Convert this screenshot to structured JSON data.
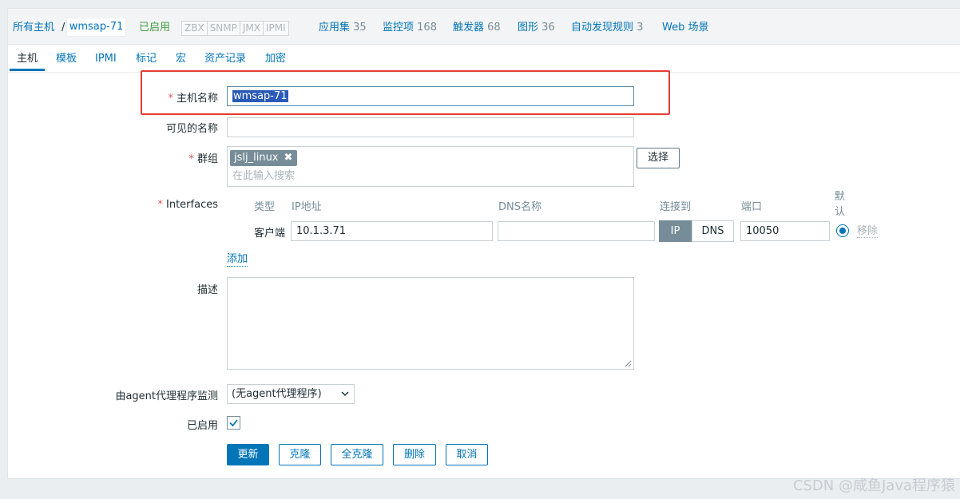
{
  "breadcrumb": {
    "all_hosts": "所有主机",
    "separator": "/",
    "host": "wmsap-71"
  },
  "header": {
    "status": "已启用",
    "availability": [
      "ZBX",
      "SNMP",
      "JMX",
      "IPMI"
    ],
    "links": [
      {
        "label": "应用集",
        "count": "35"
      },
      {
        "label": "监控项",
        "count": "168"
      },
      {
        "label": "触发器",
        "count": "68"
      },
      {
        "label": "图形",
        "count": "36"
      },
      {
        "label": "自动发现规则",
        "count": "3"
      },
      {
        "label": "Web 场景",
        "count": ""
      }
    ]
  },
  "tabs": [
    "主机",
    "模板",
    "IPMI",
    "标记",
    "宏",
    "资产记录",
    "加密"
  ],
  "form": {
    "required_mark": "*",
    "host_name_label": "主机名称",
    "host_name_value": "wmsap-71",
    "visible_name_label": "可见的名称",
    "visible_name_value": "",
    "groups_label": "群组",
    "group_tag": "jslj_linux",
    "group_tag_remove": "✖",
    "groups_placeholder": "在此输入搜索",
    "select_button": "选择",
    "interfaces_label": "Interfaces",
    "interfaces": {
      "col_type": "类型",
      "col_ip": "IP地址",
      "col_dns": "DNS名称",
      "col_connect": "连接到",
      "col_port": "端口",
      "col_default": "默认",
      "row_type": "客户端",
      "row_ip": "10.1.3.71",
      "row_dns": "",
      "connect_ip": "IP",
      "connect_dns": "DNS",
      "row_port": "10050",
      "remove": "移除"
    },
    "add_link": "添加",
    "description_label": "描述",
    "description_value": "",
    "proxy_label": "由agent代理程序监测",
    "proxy_value": "(无agent代理程序)",
    "enabled_label": "已启用",
    "enabled": true
  },
  "buttons": {
    "update": "更新",
    "clone": "克隆",
    "full_clone": "全克隆",
    "delete": "删除",
    "cancel": "取消"
  },
  "watermark": "CSDN @咸鱼Java程序猿",
  "colors": {
    "link": "#0275b8",
    "enabled_green": "#429e47",
    "required_red": "#e45959",
    "annotation_red": "#e53b32"
  }
}
